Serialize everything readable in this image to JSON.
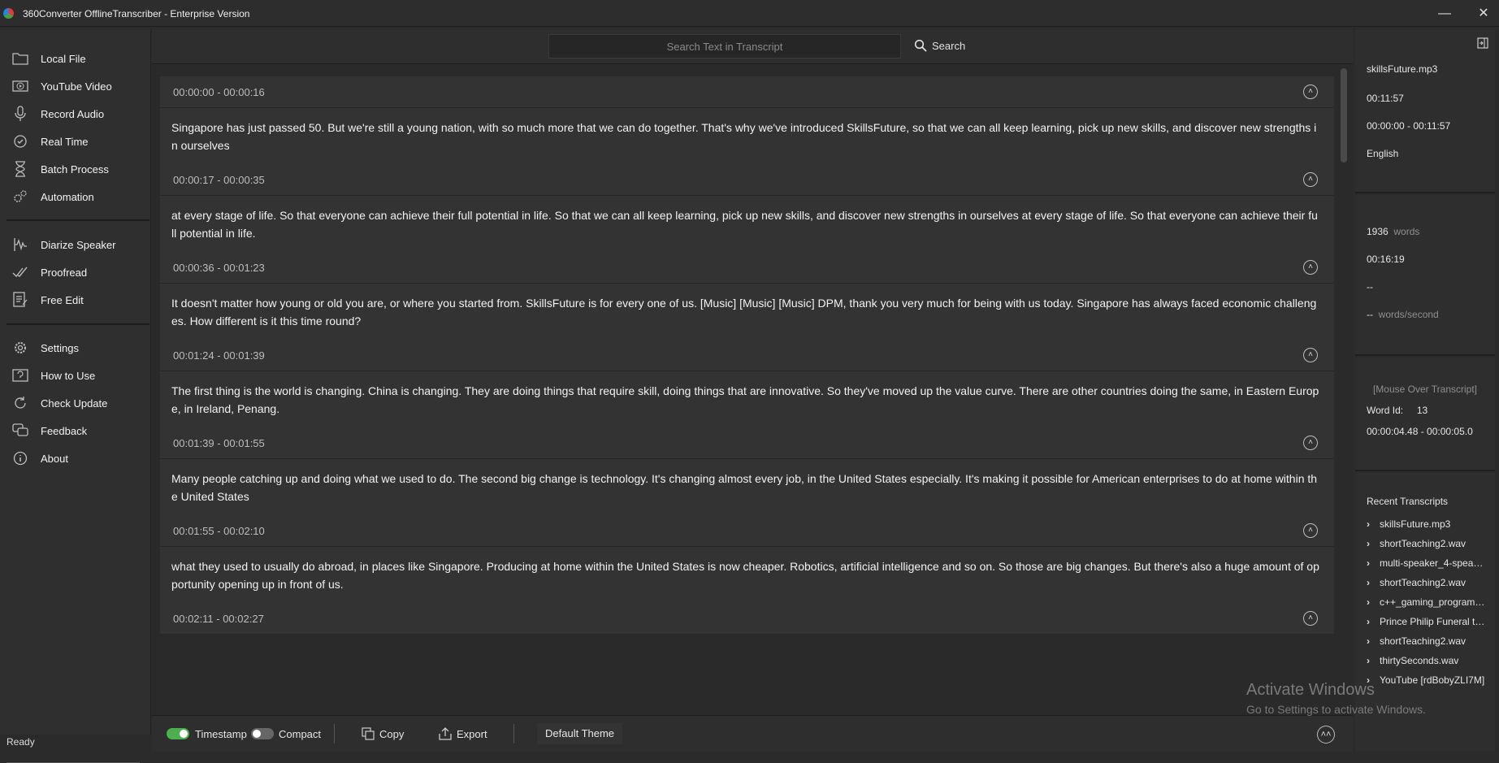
{
  "window": {
    "title": "360Converter OfflineTranscriber - Enterprise Version",
    "minimize_icon": "minimize-icon",
    "close_icon": "close-icon"
  },
  "sidebar": {
    "group1": [
      {
        "label": "Local File",
        "icon": "folder-icon"
      },
      {
        "label": "YouTube Video",
        "icon": "video-icon"
      },
      {
        "label": "Record Audio",
        "icon": "microphone-icon"
      },
      {
        "label": "Real Time",
        "icon": "realtime-icon"
      },
      {
        "label": "Batch Process",
        "icon": "hourglass-icon"
      },
      {
        "label": "Automation",
        "icon": "gears-icon"
      }
    ],
    "group2": [
      {
        "label": "Diarize Speaker",
        "icon": "speaker-wave-icon"
      },
      {
        "label": "Proofread",
        "icon": "check-icon"
      },
      {
        "label": "Free Edit",
        "icon": "edit-icon"
      }
    ],
    "group3": [
      {
        "label": "Settings",
        "icon": "gear-icon"
      },
      {
        "label": "How to Use",
        "icon": "help-icon"
      },
      {
        "label": "Check Update",
        "icon": "refresh-icon"
      },
      {
        "label": "Feedback",
        "icon": "feedback-icon"
      },
      {
        "label": "About",
        "icon": "info-icon"
      }
    ],
    "status": "Ready"
  },
  "search": {
    "placeholder": "Search Text in Transcript",
    "button_label": "Search"
  },
  "segments": [
    {
      "time": "00:00:00 - 00:00:16",
      "text": "Singapore has just passed 50. But we're still a young nation, with so much more that we can do together. That's why we've introduced SkillsFuture, so that we can all keep learning, pick up new skills, and discover new strengths in ourselves"
    },
    {
      "time": "00:00:17 - 00:00:35",
      "text": "at every stage of life. So that everyone can achieve their full potential in life. So that we can all keep learning, pick up new skills, and discover new strengths in ourselves at every stage of life. So that everyone can achieve their full potential in life."
    },
    {
      "time": "00:00:36 - 00:01:23",
      "text": "It doesn't matter how young or old you are, or where you started from. SkillsFuture is for every one of us. [Music] [Music] [Music] DPM, thank you very much for being with us today. Singapore has always faced economic challenges. How different is it this time round?"
    },
    {
      "time": "00:01:24 - 00:01:39",
      "text": "The first thing is the world is changing. China is changing. They are doing things that require skill, doing things that are innovative. So they've moved up the value curve. There are other countries doing the same, in Eastern Europe, in Ireland, Penang."
    },
    {
      "time": "00:01:39 - 00:01:55",
      "text": "Many people catching up and doing what we used to do. The second big change is technology. It's changing almost every job, in the United States especially. It's making it possible for American enterprises to do at home within the United States"
    },
    {
      "time": "00:01:55 - 00:02:10",
      "text": "what they used to usually do abroad, in places like Singapore. Producing at home within the United States is now cheaper. Robotics, artificial intelligence and so on. So those are big changes. But there's also a huge amount of opportunity opening up in front of us."
    },
    {
      "time": "00:02:11 - 00:02:27",
      "text": ""
    }
  ],
  "bottombar": {
    "timestamp_label": "Timestamp",
    "timestamp_on": true,
    "compact_label": "Compact",
    "compact_on": false,
    "copy_label": "Copy",
    "export_label": "Export",
    "theme_label": "Default Theme"
  },
  "info": {
    "filename": "skillsFuture.mp3",
    "duration": "00:11:57",
    "range": "00:00:00 - 00:11:57",
    "language": "English",
    "word_count": "1936",
    "words_label": "words",
    "elapsed": "00:16:19",
    "dash": "--",
    "rate_value": "--",
    "rate_label": "words/second",
    "mouse_over": "[Mouse Over Transcript]",
    "word_id_label": "Word Id:",
    "word_id": "13",
    "word_time": "00:00:04.48 - 00:00:05.0"
  },
  "recent": {
    "title": "Recent Transcripts",
    "items": [
      "skillsFuture.mp3",
      "shortTeaching2.wav",
      "multi-speaker_4-spea…",
      "shortTeaching2.wav",
      "c++_gaming_program…",
      "Prince Philip Funeral t…",
      "shortTeaching2.wav",
      "thirtySeconds.wav",
      "YouTube [rdBobyZLI7M]"
    ]
  },
  "watermark": {
    "title": "Activate Windows",
    "subtitle": "Go to Settings to activate Windows."
  },
  "colors": {
    "toggle_on": "#4caf50",
    "toggle_off": "#666666"
  }
}
